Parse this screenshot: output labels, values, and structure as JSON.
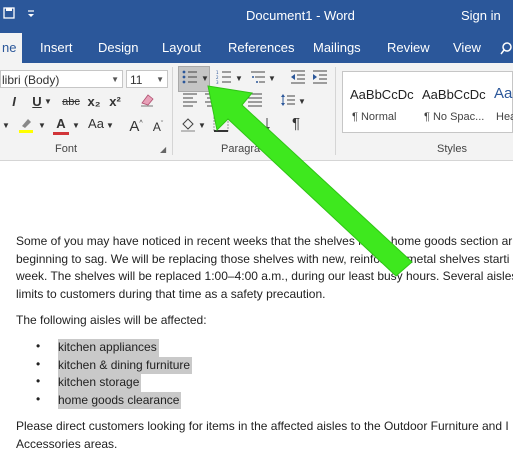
{
  "titlebar": {
    "qat_icon": "save-icon",
    "qat_customize_icon": "customize-qat-icon",
    "doc_title": "Document1 - Word",
    "signin": "Sign in"
  },
  "tabs": [
    "ne",
    "Insert",
    "Design",
    "Layout",
    "References",
    "Mailings",
    "Review",
    "View"
  ],
  "ribbon": {
    "font_name": "libri (Body)",
    "font_size": "11",
    "bold": "I",
    "underline": "U",
    "strikethrough": "abc",
    "subscript": "x₂",
    "superscript": "x²",
    "change_case": "Aa",
    "grow_font": "A",
    "shrink_font": "A",
    "pilcrow": "¶",
    "font_group": "Font",
    "paragraph_group": "Paragra",
    "styles_group": "Styles",
    "styles": [
      {
        "preview": "AaBbCcDc",
        "name": "¶ Normal"
      },
      {
        "preview": "AaBbCcDc",
        "name": "¶ No Spac..."
      },
      {
        "preview": "AaBbC",
        "name": "Hea"
      }
    ]
  },
  "document": {
    "para1": [
      "Some of you may have noticed in recent weeks that the shelves in the home goods section ar",
      "beginning to sag. We will be replacing those shelves with new, reinforced metal shelves starti",
      "week. The shelves will be replaced 1:00–4:00 a.m., during our least busy hours. Several aisles",
      "limits to customers during that time as a safety precaution."
    ],
    "para2": "The following aisles will be affected:",
    "bullet_char": "•",
    "bullets": [
      "kitchen appliances",
      "kitchen & dining furniture",
      "kitchen storage",
      "home goods clearance"
    ],
    "para3": [
      "Please direct customers looking for items in the affected aisles to the Outdoor Furniture and I",
      "Accessories areas."
    ]
  },
  "colors": {
    "word_blue": "#2b579a",
    "ribbon_bg": "#f3f3f3",
    "annotation_arrow": "#3ee81e",
    "font_color_red": "#d13438",
    "highlight_yellow": "#ffff00"
  }
}
